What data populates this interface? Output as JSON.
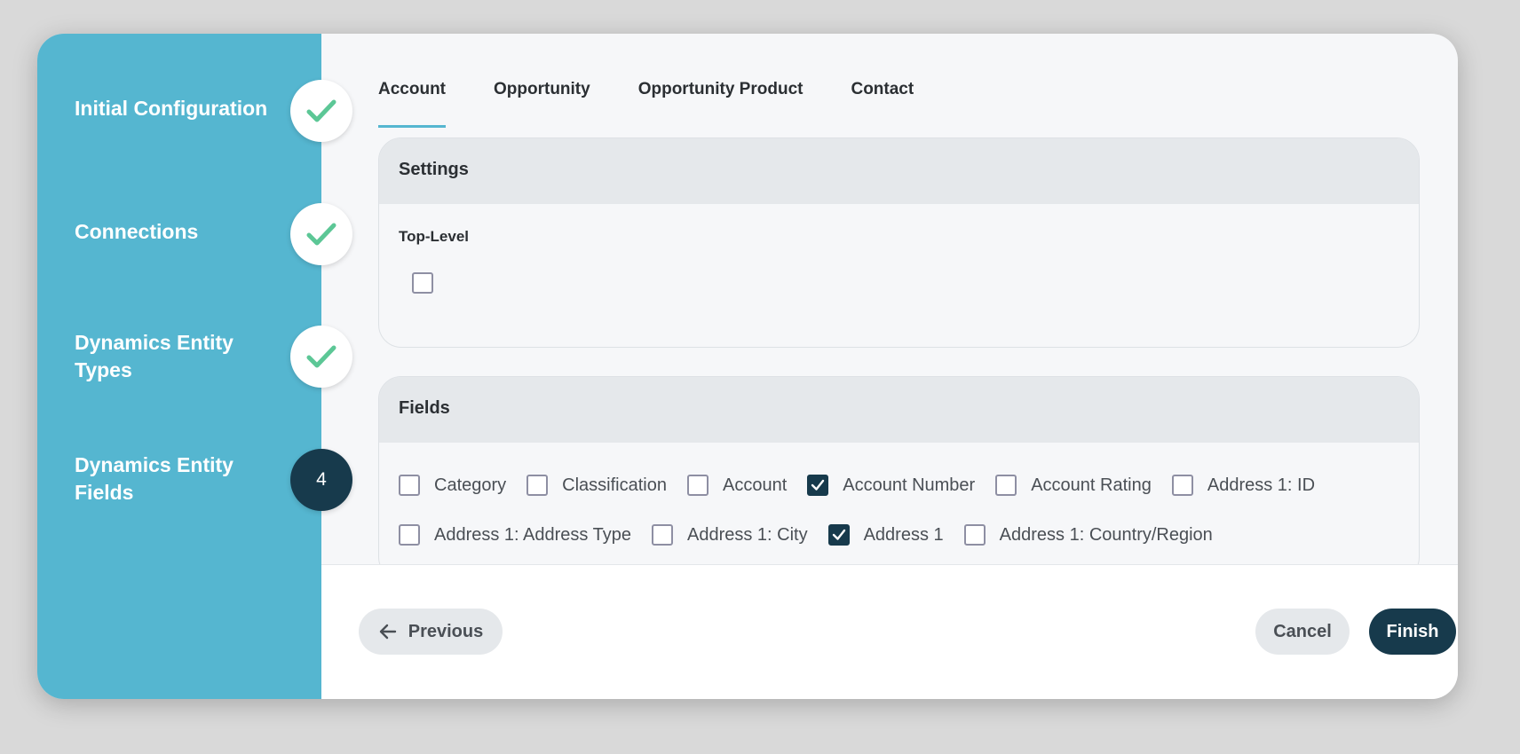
{
  "colors": {
    "sidebar": "#55b6d0",
    "primary_dark": "#173a4c",
    "check_green": "#5cc796",
    "tab_underline": "#55b6d0"
  },
  "steps": [
    {
      "label": "Initial Configuration",
      "status": "complete",
      "icon": "checkmark-icon"
    },
    {
      "label": "Connections",
      "status": "complete",
      "icon": "checkmark-icon"
    },
    {
      "label": "Dynamics Entity Types",
      "status": "complete",
      "icon": "checkmark-icon"
    },
    {
      "label": "Dynamics Entity Fields",
      "status": "active",
      "number": "4"
    }
  ],
  "tabs": [
    {
      "label": "Account",
      "active": true
    },
    {
      "label": "Opportunity",
      "active": false
    },
    {
      "label": "Opportunity Product",
      "active": false
    },
    {
      "label": "Contact",
      "active": false
    }
  ],
  "settings": {
    "title": "Settings",
    "top_level_label": "Top-Level",
    "top_level_checked": false
  },
  "fields": {
    "title": "Fields",
    "items": [
      {
        "label": "Category",
        "checked": false
      },
      {
        "label": "Classification",
        "checked": false
      },
      {
        "label": "Account",
        "checked": false
      },
      {
        "label": "Account Number",
        "checked": true
      },
      {
        "label": "Account Rating",
        "checked": false
      },
      {
        "label": "Address 1: ID",
        "checked": false
      },
      {
        "label": "Address 1: Address Type",
        "checked": false
      },
      {
        "label": "Address 1: City",
        "checked": false
      },
      {
        "label": "Address 1",
        "checked": true
      },
      {
        "label": "Address 1: Country/Region",
        "checked": false
      }
    ]
  },
  "footer": {
    "previous_label": "Previous",
    "cancel_label": "Cancel",
    "finish_label": "Finish"
  }
}
